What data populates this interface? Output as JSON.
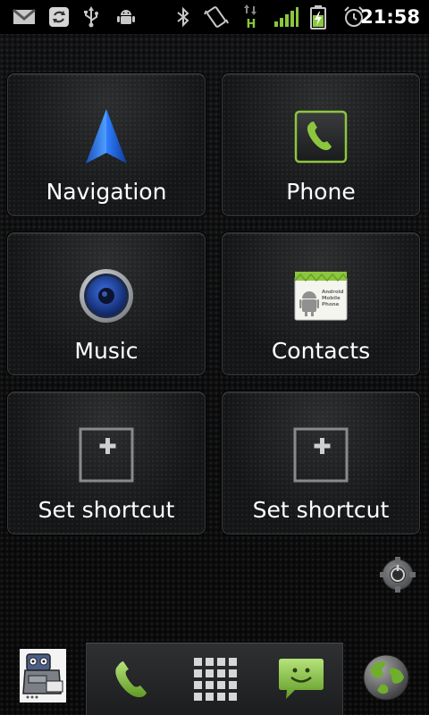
{
  "status_bar": {
    "time": "21:58",
    "icons": [
      "gmail-icon",
      "sync-icon",
      "usb-icon",
      "android-debug-icon",
      "bluetooth-icon",
      "vibrate-icon",
      "hspa-data-icon",
      "signal-icon",
      "battery-charging-icon",
      "alarm-icon"
    ],
    "data_indicator": "H"
  },
  "shortcuts": [
    {
      "label": "Navigation",
      "icon": "navigation-arrow-icon"
    },
    {
      "label": "Phone",
      "icon": "phone-icon"
    },
    {
      "label": "Music",
      "icon": "speaker-icon"
    },
    {
      "label": "Contacts",
      "icon": "contacts-card-icon"
    },
    {
      "label": "Set shortcut",
      "icon": "add-shortcut-icon"
    },
    {
      "label": "Set shortcut",
      "icon": "add-shortcut-icon"
    }
  ],
  "contacts_card_text": [
    "Android",
    "Mobile",
    "Phone"
  ],
  "dock": {
    "left_app": "robot-app-icon",
    "center_buttons": [
      "phone-dock-icon",
      "app-drawer-icon",
      "messaging-icon"
    ],
    "right_app": "browser-globe-icon"
  },
  "colors": {
    "accent_green": "#8cc63f",
    "navigation_blue": "#2f7fff",
    "text": "#ffffff"
  }
}
